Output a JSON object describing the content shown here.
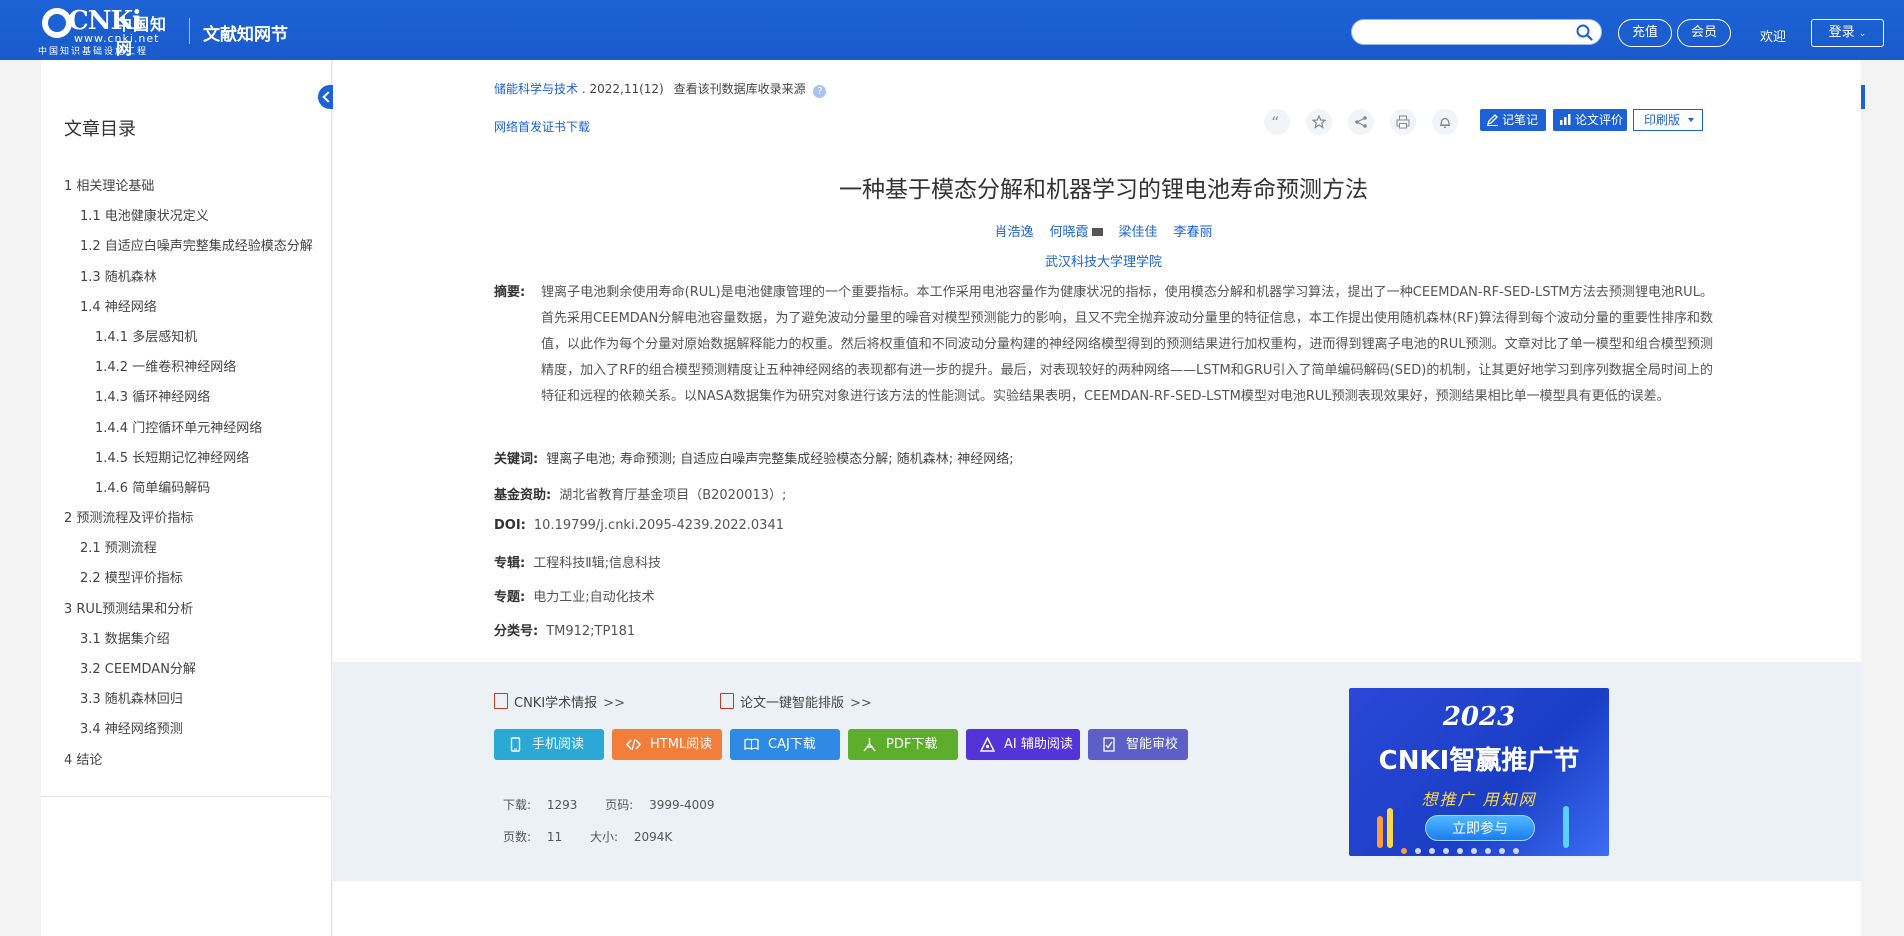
{
  "header": {
    "logo_text": "CNKi",
    "logo_cn": "中国知网",
    "logo_url": "www.cnki.net",
    "logo_sub": "中国知识基础设施工程",
    "site_name": "文献知网节",
    "search_placeholder": "",
    "recharge_label": "充值",
    "member_label": "会员",
    "welcome_text": "欢迎",
    "login_label": "登录"
  },
  "sidebar": {
    "title": "文章目录",
    "items": [
      {
        "label": "1 相关理论基础",
        "level": 1
      },
      {
        "label": "1.1 电池健康状况定义",
        "level": 2
      },
      {
        "label": "1.2 自适应白噪声完整集成经验模态分解",
        "level": 2
      },
      {
        "label": "1.3 随机森林",
        "level": 2
      },
      {
        "label": "1.4 神经网络",
        "level": 2
      },
      {
        "label": "1.4.1 多层感知机",
        "level": 3
      },
      {
        "label": "1.4.2 一维卷积神经网络",
        "level": 3
      },
      {
        "label": "1.4.3 循环神经网络",
        "level": 3
      },
      {
        "label": "1.4.4 门控循环单元神经网络",
        "level": 3
      },
      {
        "label": "1.4.5 长短期记忆神经网络",
        "level": 3
      },
      {
        "label": "1.4.6 简单编码解码",
        "level": 3
      },
      {
        "label": "2 预测流程及评价指标",
        "level": 1
      },
      {
        "label": "2.1 预测流程",
        "level": 2
      },
      {
        "label": "2.2 模型评价指标",
        "level": 2
      },
      {
        "label": "3 RUL预测结果和分析",
        "level": 1
      },
      {
        "label": "3.1 数据集介绍",
        "level": 2
      },
      {
        "label": "3.2 CEEMDAN分解",
        "level": 2
      },
      {
        "label": "3.3 随机森林回归",
        "level": 2
      },
      {
        "label": "3.4 神经网络预测",
        "level": 2
      },
      {
        "label": "4 结论",
        "level": 1
      }
    ]
  },
  "article": {
    "source_journal": "储能科学与技术",
    "source_issue": ". 2022,11(12)",
    "source_link": "查看该刊数据库收录来源",
    "help_glyph": "?",
    "cert_link": "网络首发证书下载",
    "note_label": "记笔记",
    "evaluate_label": "论文评价",
    "print_label": "印刷版",
    "title": "一种基于模态分解和机器学习的锂电池寿命预测方法",
    "authors": [
      "肖浩逸",
      "何晓霞",
      "梁佳佳",
      "李春丽"
    ],
    "organization": "武汉科技大学理学院",
    "abstract_label": "摘要:",
    "abstract": "锂离子电池剩余使用寿命(RUL)是电池健康管理的一个重要指标。本工作采用电池容量作为健康状况的指标，使用模态分解和机器学习算法，提出了一种CEEMDAN-RF-SED-LSTM方法去预测锂电池RUL。首先采用CEEMDAN分解电池容量数据，为了避免波动分量里的噪音对模型预测能力的影响，且又不完全抛弃波动分量里的特征信息，本工作提出使用随机森林(RF)算法得到每个波动分量的重要性排序和数值，以此作为每个分量对原始数据解释能力的权重。然后将权重值和不同波动分量构建的神经网络模型得到的预测结果进行加权重构，进而得到锂离子电池的RUL预测。文章对比了单一模型和组合模型预测精度，加入了RF的组合模型预测精度让五种神经网络的表现都有进一步的提升。最后，对表现较好的两种网络——LSTM和GRU引入了简单编码解码(SED)的机制，让其更好地学习到序列数据全局时间上的特征和远程的依赖关系。以NASA数据集作为研究对象进行该方法的性能测试。实验结果表明，CEEMDAN-RF-SED-LSTM模型对电池RUL预测表现效果好，预测结果相比单一模型具有更低的误差。",
    "keywords_label": "关键词:",
    "keywords": "锂离子电池;  寿命预测;  自适应白噪声完整集成经验模态分解;  随机森林;  神经网络;",
    "fund_label": "基金资助:",
    "fund": "湖北省教育厅基金项目（B2020013）;",
    "doi_label": "DOI:",
    "doi": "10.19799/j.cnki.2095-4239.2022.0341",
    "series_label": "专辑:",
    "series": "工程科技Ⅱ辑;信息科技",
    "topic_label": "专题:",
    "topic": "电力工业;自动化技术",
    "class_label": "分类号:",
    "class": "TM912;TP181"
  },
  "lower": {
    "cnki_report": "CNKI学术情报",
    "typeset": "论文一键智能排版",
    "arrows": ">>",
    "buttons": {
      "mobile": "手机阅读",
      "html": "HTML阅读",
      "caj": "CAJ下载",
      "pdf": "PDF下载",
      "ai": "AI 辅助阅读",
      "review": "智能审校"
    },
    "colors": {
      "mobile": "#2aa9d6",
      "html": "#f37d3a",
      "caj": "#2f8ae6",
      "pdf": "#5dae2d",
      "ai": "#5433d9",
      "review": "#5b5fc7"
    },
    "downloads_label": "下载:",
    "downloads": "1293",
    "pages_range_label": "页码:",
    "pages_range": "3999-4009",
    "page_count_label": "页数:",
    "page_count": "11",
    "size_label": "大小:",
    "size": "2094K"
  },
  "ad": {
    "year": "2023",
    "title": "CNKI智赢推广节",
    "slogan": "想推广 用知网",
    "button": "立即参与",
    "dot_count": 9,
    "active_dot": 0
  }
}
